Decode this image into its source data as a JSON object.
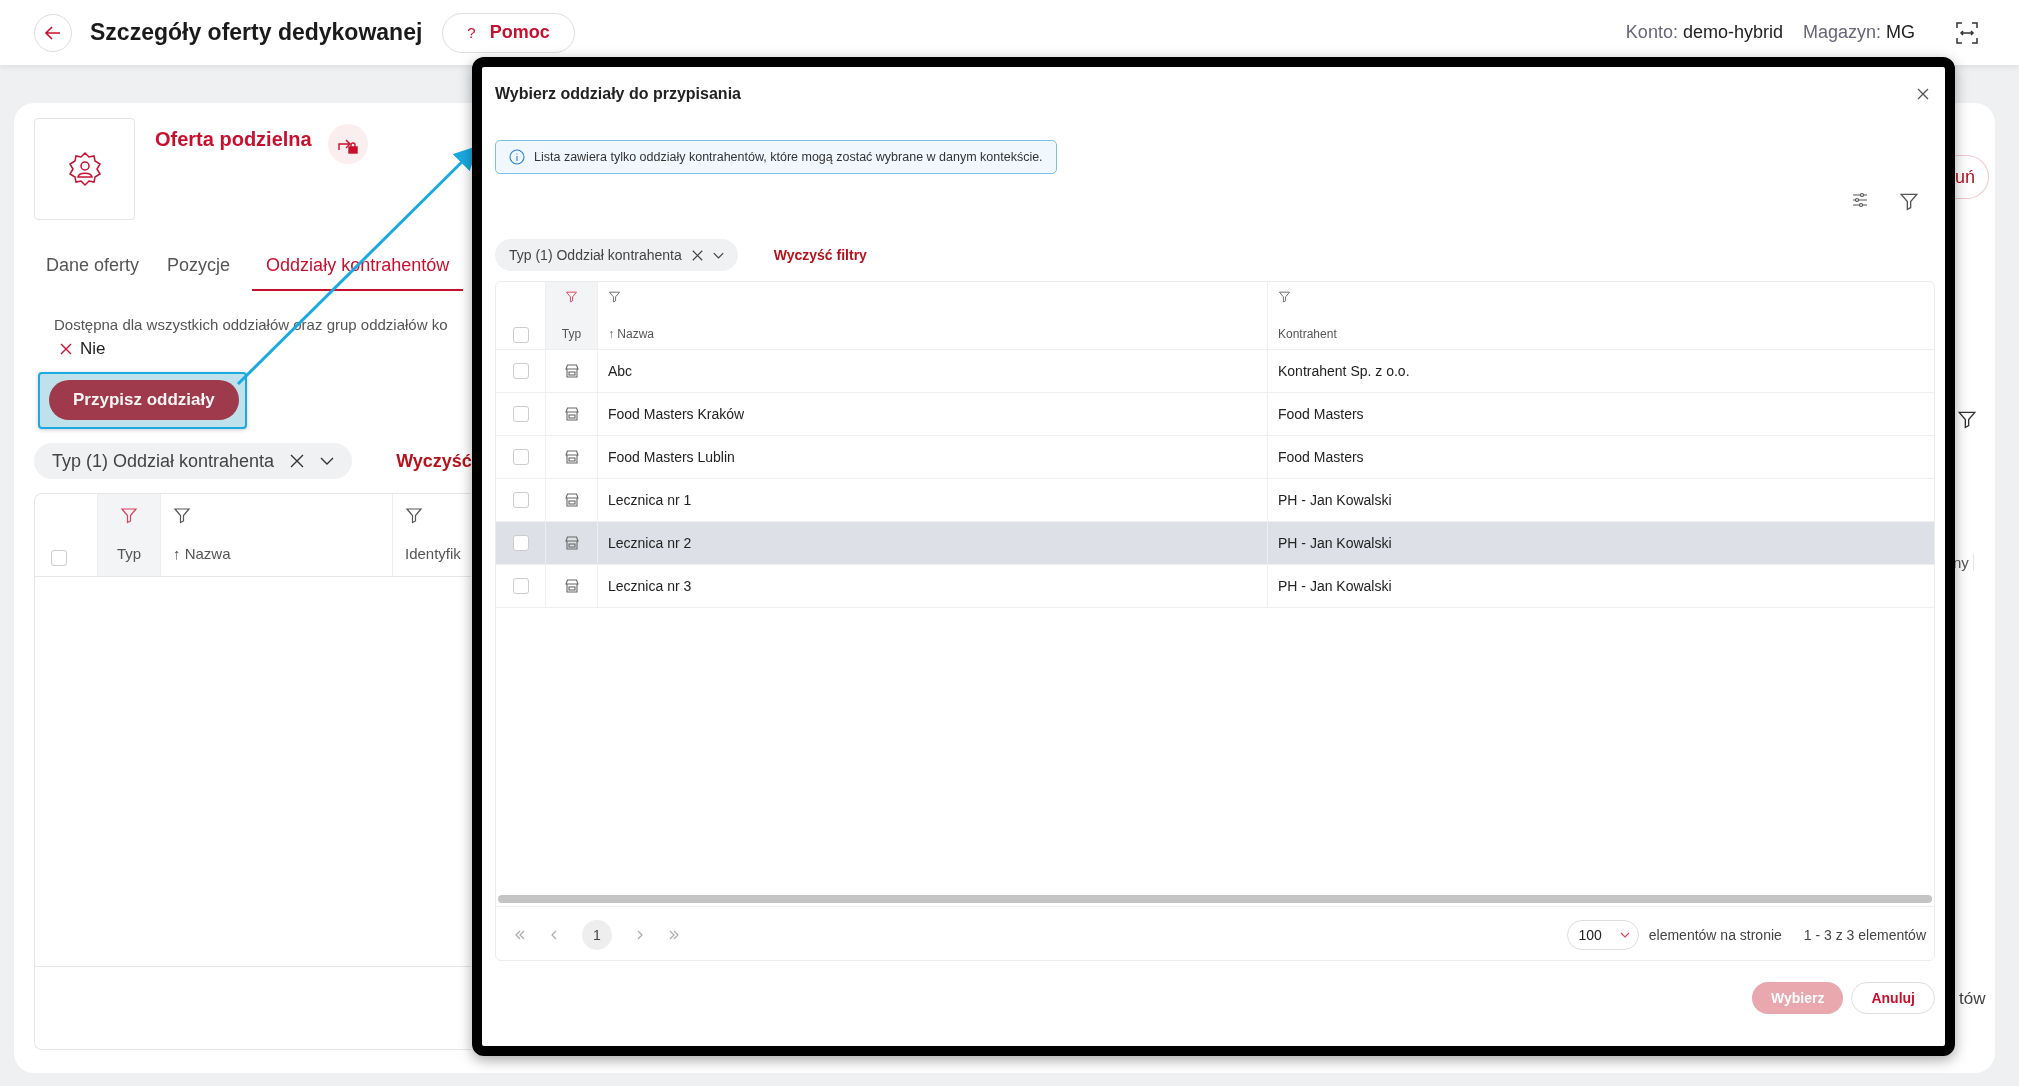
{
  "header": {
    "title": "Szczegóły oferty dedykowanej",
    "help_button": {
      "icon": "?",
      "label": "Pomoc"
    },
    "account_label": "Konto:",
    "account_value": "demo-hybrid",
    "warehouse_label": "Magazyn:",
    "warehouse_value": "MG"
  },
  "offer": {
    "title": "Oferta podzielna"
  },
  "tabs": [
    {
      "label": "Dane oferty",
      "selected": false
    },
    {
      "label": "Pozycje",
      "selected": false
    },
    {
      "label": "Oddziały kontrahentów",
      "selected": true
    }
  ],
  "availability": {
    "label": "Dostępna dla wszystkich oddziałów oraz grup oddziałów ko",
    "value": "Nie"
  },
  "assign_button": "Przypisz oddziały",
  "filter_chip": {
    "label": "Typ (1) Oddział kontrahenta"
  },
  "clear_filters": "Wyczyść",
  "table": {
    "checked": false,
    "columns": [
      {
        "label": "Typ",
        "filter_active": true
      },
      {
        "label": "↑ Nazwa",
        "filter_active": false
      },
      {
        "label": "Identyfik",
        "filter_active": false
      }
    ]
  },
  "right_fragments": {
    "button": "uń",
    "column": "ny",
    "footer": "tów"
  },
  "dialog": {
    "title": "Wybierz oddziały do przypisania",
    "info": "Lista zawiera tylko oddziały kontrahentów, które mogą zostać wybrane w danym kontekście.",
    "filter_chip": {
      "label": "Typ (1) Oddział kontrahenta"
    },
    "clear_filters": "Wyczyść filtry",
    "table": {
      "checked": false,
      "columns": [
        {
          "label": "Typ",
          "filter_active": true
        },
        {
          "label": "↑ Nazwa",
          "filter_active": false
        },
        {
          "label": "Kontrahent",
          "filter_active": false
        }
      ],
      "rows": [
        {
          "name": "Abc",
          "contractor": "Kontrahent Sp. z o.o.",
          "checked": false,
          "hovered": false
        },
        {
          "name": "Food Masters Kraków",
          "contractor": "Food Masters",
          "checked": false,
          "hovered": false
        },
        {
          "name": "Food Masters Lublin",
          "contractor": "Food Masters",
          "checked": false,
          "hovered": false
        },
        {
          "name": "Lecznica nr 1",
          "contractor": "PH - Jan Kowalski",
          "checked": false,
          "hovered": false
        },
        {
          "name": "Lecznica nr 2",
          "contractor": "PH - Jan Kowalski",
          "checked": false,
          "hovered": true
        },
        {
          "name": "Lecznica nr 3",
          "contractor": "PH - Jan Kowalski",
          "checked": false,
          "hovered": false
        }
      ]
    },
    "pagination": {
      "pages": [
        {
          "label": "1",
          "selected": true
        }
      ],
      "page_size": "100",
      "page_size_label": "elementów na stronie",
      "summary": "1 - 3 z 3 elementów"
    },
    "buttons": [
      {
        "label": "Wybierz",
        "kind": "primary",
        "disabled": true
      },
      {
        "label": "Anuluj",
        "kind": "secondary",
        "disabled": false
      }
    ]
  }
}
